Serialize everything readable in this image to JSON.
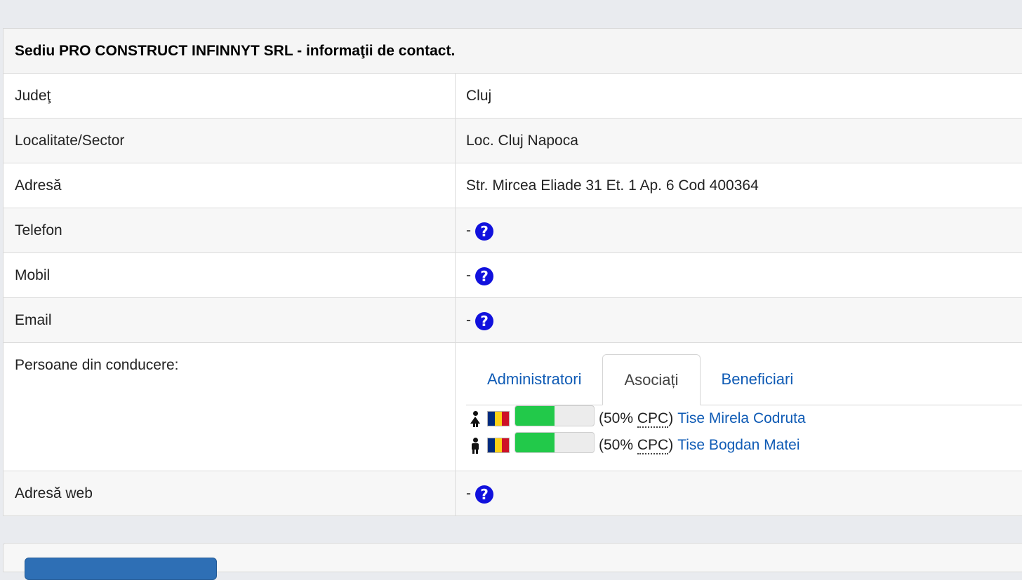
{
  "panel": {
    "title": "Sediu PRO CONSTRUCT INFINNYT SRL - informaţii de contact."
  },
  "rows": {
    "judet": {
      "label": "Judeţ",
      "value": "Cluj"
    },
    "localitate": {
      "label": "Localitate/Sector",
      "value": "Loc. Cluj Napoca"
    },
    "adresa": {
      "label": "Adresă",
      "value": "Str. Mircea Eliade 31 Et. 1 Ap. 6 Cod 400364"
    },
    "telefon": {
      "label": "Telefon",
      "value": "-"
    },
    "mobil": {
      "label": "Mobil",
      "value": "-"
    },
    "email": {
      "label": "Email",
      "value": "-"
    },
    "persoane": {
      "label": "Persoane din conducere:"
    },
    "web": {
      "label": "Adresă web",
      "value": "-"
    }
  },
  "help_icon": {
    "glyph": "?",
    "icon": "question-circle-icon",
    "color": "#1111dd"
  },
  "tabs": [
    {
      "label": "Administratori",
      "active": false
    },
    {
      "label": "Asociați",
      "active": true
    },
    {
      "label": "Beneficiari",
      "active": false
    }
  ],
  "associates": [
    {
      "gender": "female",
      "icon": "female-person-icon",
      "flag": "romania-flag-icon",
      "share_percent": 50,
      "pct_open": "(50% ",
      "abbr": "CPC",
      "pct_close": ")",
      "name": "Tise Mirela Codruta"
    },
    {
      "gender": "male",
      "icon": "male-person-icon",
      "flag": "romania-flag-icon",
      "share_percent": 50,
      "pct_open": "(50% ",
      "abbr": "CPC",
      "pct_close": ")",
      "name": "Tise Bogdan Matei"
    }
  ],
  "colors": {
    "link": "#0f5bb5",
    "bar_fill": "#22c94a",
    "flag": [
      "#002b7f",
      "#fcd116",
      "#ce1126"
    ]
  }
}
